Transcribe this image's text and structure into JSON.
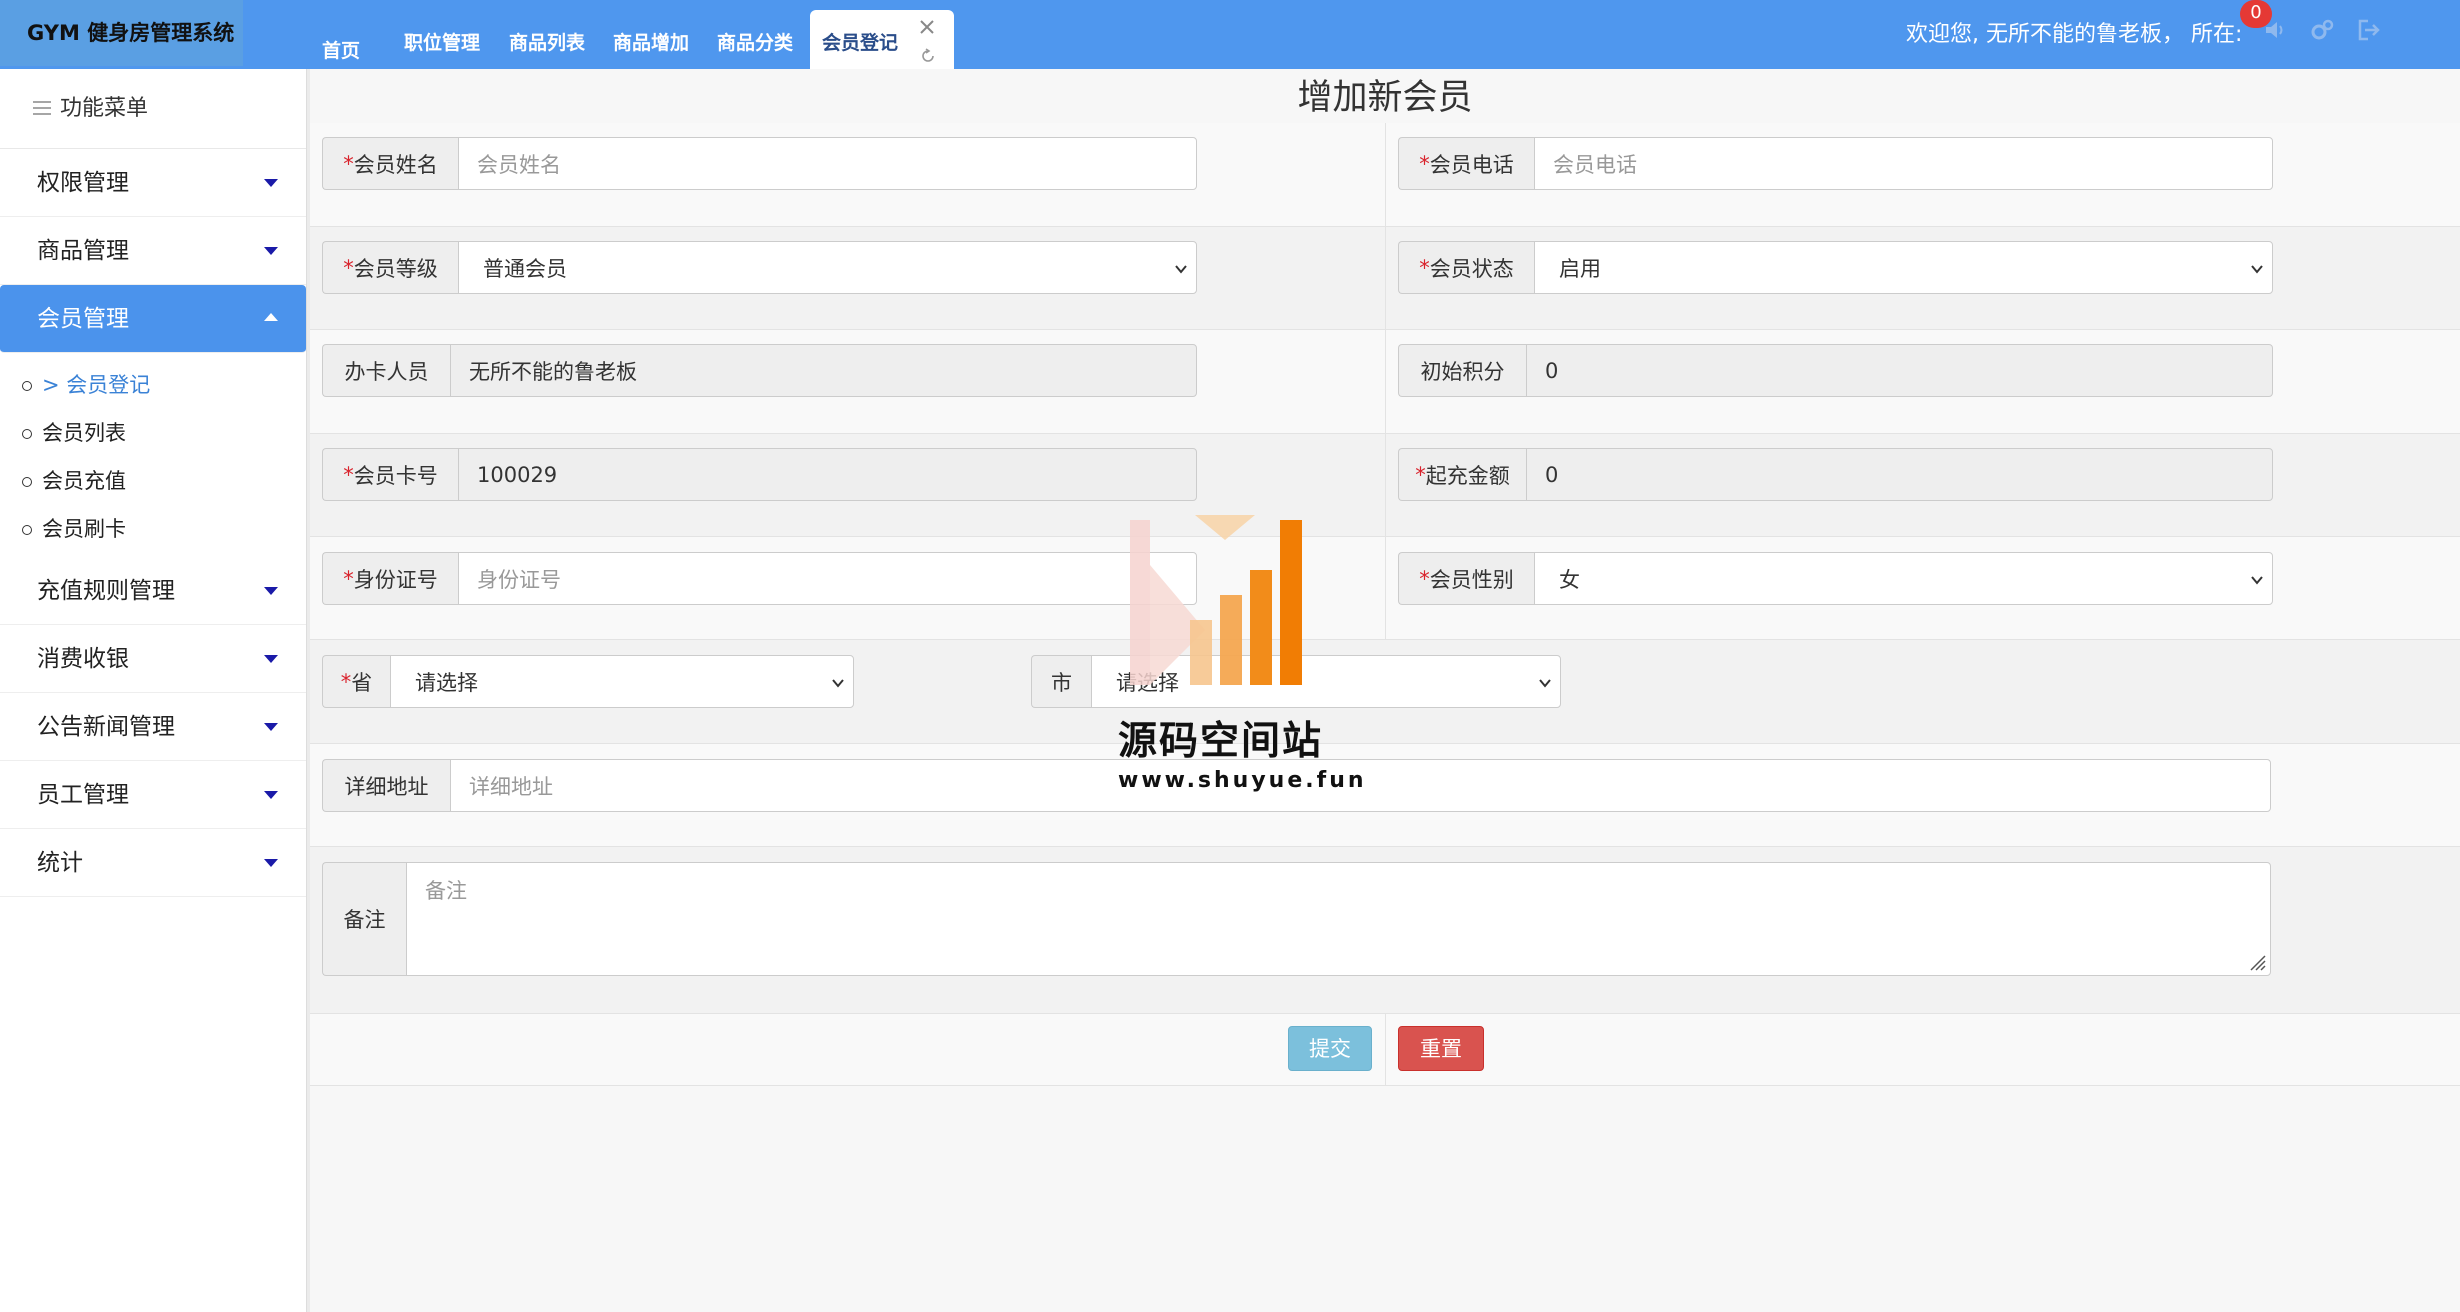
{
  "app": {
    "title": "GYM 健身房管理系统"
  },
  "tabs": [
    {
      "label": "首页"
    },
    {
      "label": "职位管理"
    },
    {
      "label": "商品列表"
    },
    {
      "label": "商品增加"
    },
    {
      "label": "商品分类"
    },
    {
      "label": "会员登记",
      "active": true
    }
  ],
  "header": {
    "welcome": "欢迎您, 无所不能的鲁老板， 所在:",
    "notification_count": "0",
    "icons": [
      "speaker-icon",
      "settings-icon",
      "logout-icon"
    ]
  },
  "sidebar": {
    "menu_title": "功能菜单",
    "items": [
      {
        "label": "权限管理"
      },
      {
        "label": "商品管理"
      },
      {
        "label": "会员管理",
        "open": true,
        "children": [
          {
            "label": "> 会员登记",
            "current": true
          },
          {
            "label": "会员列表"
          },
          {
            "label": "会员充值"
          },
          {
            "label": "会员刷卡"
          }
        ]
      },
      {
        "label": "充值规则管理"
      },
      {
        "label": "消费收银"
      },
      {
        "label": "公告新闻管理"
      },
      {
        "label": "员工管理"
      },
      {
        "label": "统计"
      }
    ]
  },
  "form": {
    "title": "增加新会员",
    "required_mark": "*",
    "name": {
      "label": "会员姓名",
      "placeholder": "会员姓名"
    },
    "phone": {
      "label": "会员电话",
      "placeholder": "会员电话"
    },
    "level": {
      "label": "会员等级",
      "value": "普通会员"
    },
    "status": {
      "label": "会员状态",
      "value": "启用"
    },
    "operator": {
      "label": "办卡人员",
      "value": "无所不能的鲁老板"
    },
    "points": {
      "label": "初始积分",
      "value": "0"
    },
    "card_no": {
      "label": "会员卡号",
      "value": "100029"
    },
    "min_recharge": {
      "label": "起充金额",
      "value": "0"
    },
    "id_card": {
      "label": "身份证号",
      "placeholder": "身份证号"
    },
    "gender": {
      "label": "会员性别",
      "value": "女"
    },
    "province": {
      "label": "省",
      "value": "请选择"
    },
    "city": {
      "label": "市",
      "value": "请选择"
    },
    "address": {
      "label": "详细地址",
      "placeholder": "详细地址"
    },
    "remark": {
      "label": "备注",
      "placeholder": "备注"
    },
    "submit_label": "提交",
    "reset_label": "重置"
  },
  "watermark": {
    "title": "源码空间站",
    "url": "www.shuyue.fun"
  },
  "colors": {
    "topbar": "#4f97ee",
    "active_menu": "#4b93ec",
    "submit": "#7cc0dc",
    "reset": "#d9534f",
    "required": "#d9232d"
  }
}
